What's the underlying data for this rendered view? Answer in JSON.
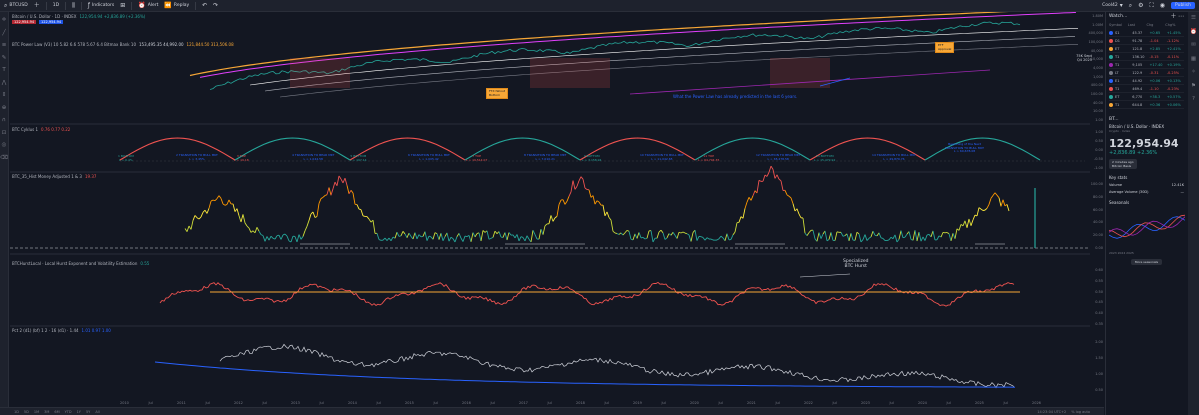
{
  "toolbar": {
    "symbol": "BTCUSD",
    "interval": "1D",
    "indicators_label": "Indicators",
    "alert_label": "Alert",
    "replay_label": "Replay",
    "layout_label": "Cool42",
    "publish_label": "Publish"
  },
  "pane1": {
    "title": "Bitcoin / U.S. Dollar · 1D · INDEX",
    "ohlc": "122,954.94 +2,836.89 (+2.36%)",
    "badge_sell": "122,954.94",
    "badge_buy": "122,954.94",
    "indicator": "BTC Power Law (V3) 10 5.82 6.6 578 5.67 6.4 Bitmax Bank 10",
    "indicator_values": "153,495.35  44,992.00",
    "indicator_values2": "121,844.50  313,506.08",
    "annotation": "What the Power Law has already predicted in the last 6 years.",
    "box1": "FTX fallout\nBottom",
    "box2": "ETF\nApproval",
    "price_right": "75K Sept\nQ4 2025",
    "axis": [
      "1.80M",
      "1.00M",
      "400,000",
      "100,000",
      "40,000",
      "10,000",
      "4,000",
      "1,000",
      "400.00",
      "100.00",
      "40.00",
      "10.00",
      "1.00"
    ]
  },
  "pane2": {
    "title": "BTC Cyklus 1",
    "values": "0.76  0.77  0.22",
    "axis": [
      "1.00",
      "0.50",
      "0.00",
      "-0.50",
      "-1.00"
    ],
    "phases": [
      {
        "label": "1 BOTTOM\nL > 0.4%",
        "color": "#26a69a"
      },
      {
        "label": "2 TRANSITION TO BULL MKT\nL > 3.45%",
        "color": "#2962ff"
      },
      {
        "label": "3 TOP\nL > 19.18",
        "color": "#ef5350"
      },
      {
        "label": "4 TRANSITION TO BEAR MKT\nL > 1,044.58",
        "color": "#2962ff"
      },
      {
        "label": "5 BOTTOM\nL > 197.14",
        "color": "#26a69a"
      },
      {
        "label": "6 TRANSITION TO BULL MKT\nL > 1,005.42",
        "color": "#2962ff"
      },
      {
        "label": "7 TOP\nL > 19,514.07",
        "color": "#ef5350"
      },
      {
        "label": "8 TRANSITION TO BEAR MKT\nL > 7,010.21",
        "color": "#2962ff"
      },
      {
        "label": "9 BOTTOM\nL > 3,158.94",
        "color": "#26a69a"
      },
      {
        "label": "10 TRANSITION TO BULL MKT\nL > 11,042.65",
        "color": "#2962ff"
      },
      {
        "label": "11 TOP\nL > 64,794.35",
        "color": "#ef5350"
      },
      {
        "label": "12 TRANSITION TO BEAR MKT\nL > 38,278.58",
        "color": "#2962ff"
      },
      {
        "label": "13 BOTTOM\nL > 15,479.92",
        "color": "#26a69a"
      },
      {
        "label": "14 TRANSITION TO BULL MKT\nL > 49,879.76",
        "color": "#2962ff"
      },
      {
        "label": "Beginning of the Next\nTRANSITION TO BULL MKT\nL > 60,678.08",
        "color": "#2962ff"
      }
    ]
  },
  "pane3": {
    "title": "BTC_35_Hist Money Adjusted 1 & 3",
    "values": "19.37",
    "axis": [
      "100.00",
      "80.00",
      "60.00",
      "40.00",
      "20.00",
      "0.00"
    ]
  },
  "pane4": {
    "title": "BTCHurstLocal · Local Hurst Exponent and Volatility Estimation",
    "values": "0.55",
    "note": "Specialized\nBTC Hurst",
    "axis": [
      "0.60",
      "0.55",
      "0.50",
      "0.45",
      "0.40",
      "0.35"
    ]
  },
  "pane5": {
    "title": "Pct 2 (d1) (bf) 1 2 · 16 (d1) · 1.44",
    "values": "1.01  0.97  1.00",
    "axis": [
      "2.00",
      "1.50",
      "1.00",
      "0.50"
    ]
  },
  "xaxis": [
    "2010",
    "Jul",
    "2011",
    "Jul",
    "2012",
    "Jul",
    "2013",
    "Jul",
    "2014",
    "Jul",
    "2015",
    "Jul",
    "2016",
    "Jul",
    "2017",
    "Jul",
    "2018",
    "Jul",
    "2019",
    "Jul",
    "2020",
    "Jul",
    "2021",
    "Jul",
    "2022",
    "Jul",
    "2023",
    "Jul",
    "2024",
    "Jul",
    "2025",
    "Jul",
    "2026"
  ],
  "bottombar": {
    "ranges": [
      "1D",
      "5D",
      "1M",
      "3M",
      "6M",
      "YTD",
      "1Y",
      "5Y",
      "All"
    ],
    "time": "14:23:04 UTC+2",
    "scale": "% log auto"
  },
  "watchlist": {
    "title": "Watch...",
    "columns": [
      "Symbol",
      "Last",
      "Chg",
      "Chg%"
    ],
    "rows": [
      {
        "sym": "S1",
        "last": "45.37",
        "chg": "+0.65",
        "pct": "+1.45%",
        "dir": "pos",
        "color": "#2962ff"
      },
      {
        "sym": "D1",
        "last": "91.78",
        "chg": "-1.04",
        "pct": "-1.12%",
        "dir": "neg",
        "color": "#ef5350"
      },
      {
        "sym": "ET",
        "last": "121.8",
        "chg": "+2.85",
        "pct": "+2.41%",
        "dir": "pos",
        "color": "#f7a737"
      },
      {
        "sym": "T1",
        "last": "136.10",
        "chg": "-0.15",
        "pct": "-0.11%",
        "dir": "neg",
        "color": "#26a69a"
      },
      {
        "sym": "T1",
        "last": "9,105",
        "chg": "+17.40",
        "pct": "+0.19%",
        "dir": "pos",
        "color": "#9c27b0"
      },
      {
        "sym": "LT",
        "last": "122.9",
        "chg": "-0.31",
        "pct": "-0.25%",
        "dir": "neg",
        "color": "#787b86"
      },
      {
        "sym": "E1",
        "last": "44.92",
        "chg": "+0.06",
        "pct": "+0.13%",
        "dir": "pos",
        "color": "#2962ff"
      },
      {
        "sym": "T1",
        "last": "469.4",
        "chg": "-1.10",
        "pct": "-0.23%",
        "dir": "neg",
        "color": "#ef5350"
      },
      {
        "sym": "ET",
        "last": "6,770",
        "chg": "+38.3",
        "pct": "+0.57%",
        "dir": "pos",
        "color": "#26a69a"
      },
      {
        "sym": "T1",
        "last": "644.8",
        "chg": "+0.36",
        "pct": "+0.06%",
        "dir": "pos",
        "color": "#f7a737"
      }
    ],
    "detail": {
      "symbol": "BT...",
      "name": "Bitcoin / U.S. Dollar · INDEX",
      "sub": "Crypto · Index",
      "price": "122,954.94",
      "change": "+2,836.89  +2.36%",
      "market": "2 minutes ago\nBitcoin Basis",
      "key_stats": "Key stats",
      "volume_label": "Volume",
      "volume": "12.41K",
      "avg_volume_label": "Average Volume (30D)",
      "avg_volume": "—",
      "seasonals": "Seasonals",
      "seasonal_legend": "2023  2024  2025",
      "more_button": "More seasonals"
    }
  }
}
